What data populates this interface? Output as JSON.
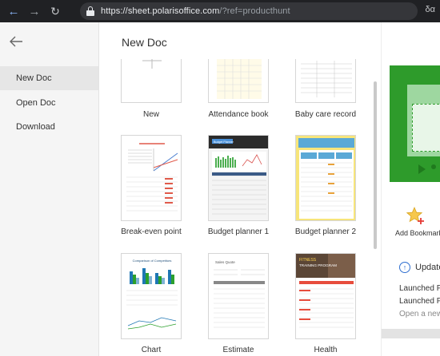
{
  "browser": {
    "url_main": "https://sheet.polarisoffice.com",
    "url_rest": "/?ref=producthunt",
    "extension_label": "δα"
  },
  "sidebar": {
    "items": [
      {
        "label": "New Doc",
        "active": true
      },
      {
        "label": "Open Doc",
        "active": false
      },
      {
        "label": "Download",
        "active": false
      }
    ]
  },
  "main": {
    "title": "New Doc",
    "templates": [
      {
        "label": "New"
      },
      {
        "label": "Attendance book"
      },
      {
        "label": "Baby care record"
      },
      {
        "label": "Break-even point"
      },
      {
        "label": "Budget planner 1"
      },
      {
        "label": "Budget planner 2"
      },
      {
        "label": "Chart"
      },
      {
        "label": "Estimate"
      },
      {
        "label": "Health"
      }
    ]
  },
  "thumb_text": {
    "budget_planner_1_tag": "Budget Planner",
    "chart_title": "Comparison of Competitors",
    "estimate_title": "Sales Quote",
    "health_title_1": "FITNESS",
    "health_title_2": "TRAINING PROGRAM"
  },
  "right_panel": {
    "bookmark_label": "Add Bookmark",
    "update_label": "Update",
    "lines": [
      "Launched P",
      "Launched P",
      "Open a new"
    ]
  },
  "colors": {
    "browser_bar": "#202124",
    "sidebar_bg": "#f5f5f5",
    "active_item": "#e6e6e6",
    "promo_green": "#2e9b2b",
    "update_blue": "#2f6fd0"
  }
}
